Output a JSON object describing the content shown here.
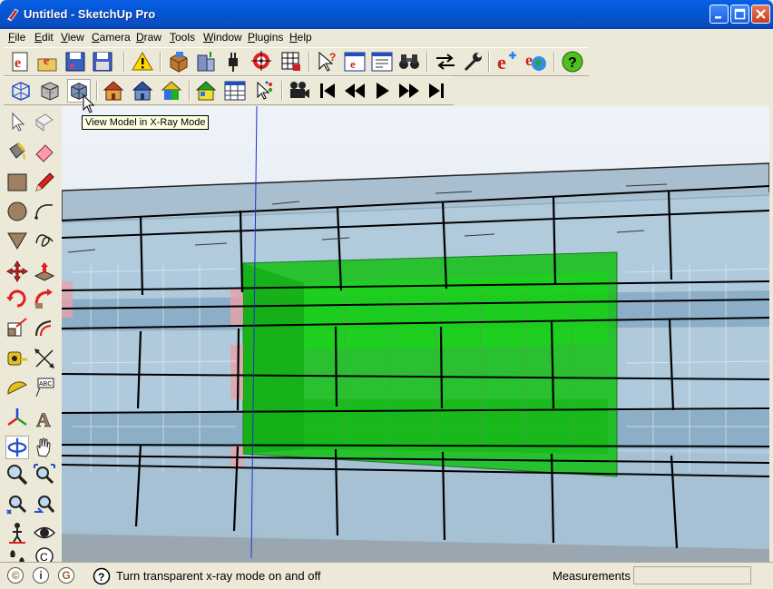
{
  "window": {
    "title": "Untitled - SketchUp Pro"
  },
  "menu": [
    {
      "label": "File",
      "u": "F",
      "rest": "ile"
    },
    {
      "label": "Edit",
      "u": "E",
      "rest": "dit"
    },
    {
      "label": "View",
      "u": "V",
      "rest": "iew"
    },
    {
      "label": "Camera",
      "u": "C",
      "rest": "amera"
    },
    {
      "label": "Draw",
      "u": "D",
      "rest": "raw"
    },
    {
      "label": "Tools",
      "u": "T",
      "rest": "ools"
    },
    {
      "label": "Window",
      "u": "W",
      "rest": "indow"
    },
    {
      "label": "Plugins",
      "u": "P",
      "rest": "lugins"
    },
    {
      "label": "Help",
      "u": "H",
      "rest": "elp"
    }
  ],
  "toolbar1_icons": [
    "ie-new-icon",
    "ie-open-icon",
    "ie-save-icon",
    "ie-saveas-icon",
    "warning-icon",
    "component-box-icon",
    "building-upload-icon",
    "plug-icon",
    "target-icon",
    "grid-icon",
    "whats-this-icon",
    "ie-window-icon",
    "dialog-icon",
    "binoculars-icon",
    "swap-arrows-icon",
    "wrench-icon",
    "ie-plus-icon",
    "ie-globe-icon",
    "help-icon"
  ],
  "toolbar2_icons": [
    "xray-cube-icon",
    "wireframe-cube-icon",
    "xray-mode-icon",
    "house-icon",
    "house-blue-icon",
    "house-color-icon",
    "house-green-icon",
    "window-grid-icon",
    "select-sparkle-icon",
    "movie-camera-icon",
    "skip-start-icon",
    "rewind-icon",
    "play-icon",
    "fast-forward-icon",
    "skip-end-icon"
  ],
  "left_tools": [
    "select-icon",
    "eraser-box-icon",
    "paint-bucket-icon",
    "eraser-icon",
    "rectangle-icon",
    "pencil-icon",
    "circle-icon",
    "arc-icon",
    "polygon-icon",
    "freehand-icon",
    "move-icon",
    "push-pull-icon",
    "rotate-icon",
    "follow-me-icon",
    "scale-icon",
    "offset-icon",
    "tape-measure-icon",
    "dimension-icon",
    "protractor-icon",
    "text-icon",
    "axes-icon",
    "3d-text-icon",
    "orbit-icon",
    "pan-icon",
    "zoom-icon",
    "zoom-window-icon",
    "zoom-extents-icon",
    "previous-view-icon",
    "position-camera-icon",
    "look-around-icon",
    "walk-icon",
    "section-icon"
  ],
  "tooltip": {
    "text": "View Model in X-Ray Mode"
  },
  "status": {
    "message": "Turn transparent x-ray mode on and off",
    "measurements_label": "Measurements",
    "measurements_value": ""
  },
  "colors": {
    "titlebar": "#0a5fe6",
    "glass": "#a7c4d8",
    "green": "#12c012",
    "frame": "#000000"
  }
}
